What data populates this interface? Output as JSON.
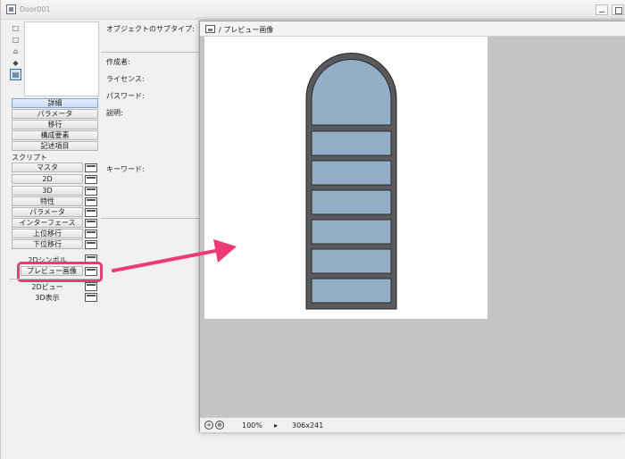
{
  "window": {
    "title": "Door001"
  },
  "tools": [
    "□",
    "□",
    "⌂",
    "◆",
    "▤"
  ],
  "buttons": [
    "詳細",
    "パラメータ",
    "移行",
    "構成要素",
    "記述項目"
  ],
  "script_section": {
    "label": "スクリプト",
    "items": [
      "マスタ",
      "2D",
      "3D",
      "特性",
      "パラメータ",
      "インターフェース",
      "上位移行",
      "下位移行"
    ]
  },
  "symbol_label": "2Dシンボル",
  "preview_button": "プレビュー画像",
  "extra_items": [
    "2Dビュー",
    "3D表示"
  ],
  "fields": {
    "subtype": "オブジェクトのサブタイプ:",
    "author": "作成者:",
    "license": "ライセンス:",
    "password": "パスワード:",
    "description": "説明:",
    "keywords": "キーワード:"
  },
  "preview": {
    "title": "/ プレビュー画像",
    "zoom": "100%",
    "size": "306x241",
    "play": "▸",
    "zoom_in": "+",
    "zoom_fit": "⊕"
  },
  "colors": {
    "highlight": "#ec3a79",
    "glass": "#93aec7",
    "frame": "#5a5a5e"
  }
}
